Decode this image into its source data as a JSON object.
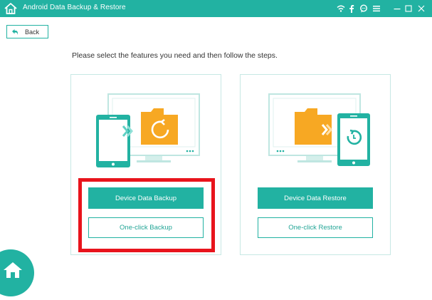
{
  "app": {
    "title": "Android Data Backup & Restore"
  },
  "titlebar_icons": [
    "home-icon",
    "wifi-icon",
    "facebook-icon",
    "chat-icon",
    "menu-icon",
    "minimize-icon",
    "maximize-icon",
    "close-icon"
  ],
  "nav": {
    "back_label": "Back"
  },
  "main": {
    "instruction": "Please select the features you need and then follow the steps.",
    "backup": {
      "primary_label": "Device Data Backup",
      "secondary_label": "One-click Backup"
    },
    "restore": {
      "primary_label": "Device Data Restore",
      "secondary_label": "One-click Restore"
    }
  },
  "colors": {
    "accent": "#22b2a2",
    "folder": "#f7a823",
    "panel_border": "#c7e8e4",
    "highlight": "#e8141c"
  }
}
